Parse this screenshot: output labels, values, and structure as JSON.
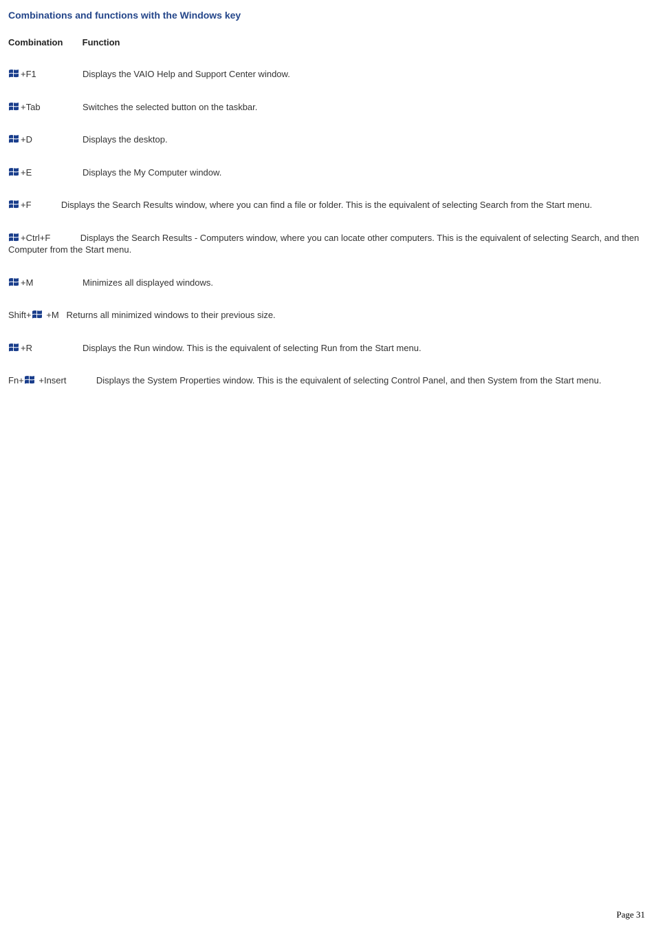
{
  "title": "Combinations and functions with the Windows key",
  "headers": {
    "combination": "Combination",
    "function": "Function"
  },
  "entries": [
    {
      "prefix": "",
      "suffix": "+F1",
      "func": "Displays the VAIO Help and Support Center window.",
      "inline": true
    },
    {
      "prefix": "",
      "suffix": "+Tab",
      "func": "Switches the selected button on the taskbar.",
      "inline": true
    },
    {
      "prefix": "",
      "suffix": "+D",
      "func": "Displays the desktop.",
      "inline": true
    },
    {
      "prefix": "",
      "suffix": "+E",
      "func": "Displays the My Computer window.",
      "inline": true
    },
    {
      "prefix": "",
      "suffix": "+F",
      "func": "Displays the Search Results window, where you can find a file or folder. This is the equivalent of selecting Search from the Start menu.",
      "inline": false
    },
    {
      "prefix": "",
      "suffix": "+Ctrl+F",
      "func": "Displays the Search Results - Computers window, where you can locate other computers. This is the equivalent of selecting Search, and then Computer from the Start menu.",
      "inline": false
    },
    {
      "prefix": "",
      "suffix": "+M",
      "func": "Minimizes all displayed windows.",
      "inline": true
    },
    {
      "prefix": "Shift+",
      "suffix": " +M",
      "func": "Returns all minimized windows to their previous size.",
      "inline": true,
      "narrow": true
    },
    {
      "prefix": "",
      "suffix": "+R",
      "func": "Displays the Run window. This is the equivalent of selecting Run from the Start menu.",
      "inline": true
    },
    {
      "prefix": "Fn+",
      "suffix": " +Insert",
      "func": "Displays the System Properties window. This is the equivalent of selecting Control Panel, and then System from the Start menu.",
      "inline": false,
      "narrow": true
    }
  ],
  "footer": "Page 31"
}
